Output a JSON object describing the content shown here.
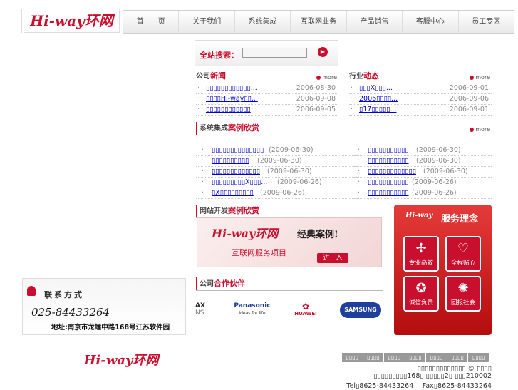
{
  "brand": {
    "logo_text": "Hi-way环网"
  },
  "nav": [
    "首　　页",
    "关于我们",
    "系统集成",
    "互联网业务",
    "产品销售",
    "客服中心",
    "员工专区"
  ],
  "search": {
    "label": "全站搜索：",
    "value": "",
    "go": "▶"
  },
  "company_news": {
    "t1": "公司",
    "t2": "新闻",
    "more": "more",
    "items": [
      {
        "title": "▯▯▯▯▯▯▯▯▯▯▯▯...",
        "date": "2006-08-30"
      },
      {
        "title": "▯▯▯▯Hi-way▯▯...",
        "date": "2006-09-08"
      },
      {
        "title": "▯▯▯▯▯▯▯▯▯▯▯▯",
        "date": "2006-09-05"
      }
    ]
  },
  "industry_news": {
    "t1": "行业",
    "t2": "动态",
    "more": "more",
    "items": [
      {
        "title": "▯▯▯X▯▯▯...",
        "date": "2006-09-01"
      },
      {
        "title": "2006▯▯▯▯...",
        "date": "2006-09-06"
      },
      {
        "title": "▯17▯▯▯▯▯...",
        "date": "2006-09-01"
      }
    ]
  },
  "cases": {
    "t1": "系统集成",
    "t2": "案例欣赏",
    "more": "more",
    "left": [
      {
        "title": "▯▯▯▯▯▯▯▯▯▯▯▯▯▯",
        "date": "(2009-06-30)"
      },
      {
        "title": "▯▯▯▯▯▯▯▯▯▯",
        "date": "(2009-06-30)"
      },
      {
        "title": "▯▯▯▯▯▯▯▯▯▯▯▯▯",
        "date": "(2009-06-30)"
      },
      {
        "title": "▯▯▯▯▯▯▯▯▯X▯▯▯...",
        "date": "(2009-06-26)"
      },
      {
        "title": "▯X▯▯▯▯▯▯▯▯▯",
        "date": "(2009-06-26)"
      }
    ],
    "right": [
      {
        "title": "▯▯▯▯▯▯▯▯▯▯▯",
        "date": "(2009-06-30)"
      },
      {
        "title": "▯▯▯▯▯▯▯▯▯▯▯",
        "date": "(2009-06-30)"
      },
      {
        "title": "▯▯▯▯▯▯▯▯▯▯▯▯▯",
        "date": "(2009-06-30)"
      },
      {
        "title": "▯▯▯▯▯▯▯▯▯▯▯",
        "date": "(2009-06-26)"
      },
      {
        "title": "▯▯▯▯▯▯▯▯▯▯▯",
        "date": "(2009-06-26)"
      }
    ]
  },
  "web_dev": {
    "t1": "网站开发",
    "t2": "案例欣赏"
  },
  "banner": {
    "logo": "Hi-way环网",
    "slogan": "经典案例!",
    "subtitle": "互联网服务项目",
    "enter": "进　入"
  },
  "service": {
    "brand": "Hi-way",
    "title": "服务理念",
    "tiles": [
      {
        "icon": "✢",
        "label": "专业高效"
      },
      {
        "icon": "♡",
        "label": "全程贴心"
      },
      {
        "icon": "✪",
        "label": "诚信负责"
      },
      {
        "icon": "✺",
        "label": "回报社会"
      }
    ]
  },
  "contact": {
    "title": "联系方式",
    "phone": "025-84433264",
    "address": "地址:南京市龙蟠中路168号江苏软件园"
  },
  "partners": {
    "t1": "公司",
    "t2": "合作伙伴",
    "names": [
      "AX",
      "Panasonic",
      "HUAWEI",
      "SAMSUNG"
    ],
    "sub": [
      "NS",
      "ideas for life",
      "",
      ""
    ]
  },
  "footer": {
    "logo": "Hi-way环网",
    "links": [
      "▯▯▯▯",
      "▯▯▯▯",
      "▯▯▯▯",
      "▯▯▯▯",
      "▯▯▯▯",
      "▯▯▯▯",
      "▯▯▯▯"
    ],
    "line1": "▯▯▯▯▯▯▯▯▯▯▯▯▯ ©  ▯▯▯▯",
    "line2": "▯▯▯▯▯▯▯▯▯168▯ ▯▯▯▯▯2▯ ▯▯▯210002",
    "line3": "Tel▯8625-84433264　 Fax▯8625-84433264"
  },
  "colors": {
    "accent": "#c8102e",
    "link": "#0000cc"
  }
}
